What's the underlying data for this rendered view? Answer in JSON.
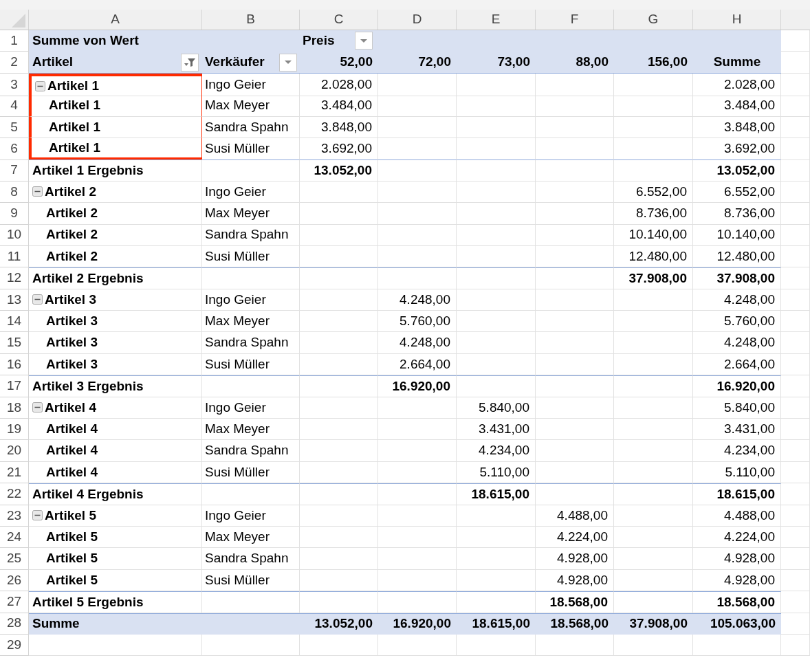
{
  "columns": [
    "A",
    "B",
    "C",
    "D",
    "E",
    "F",
    "G",
    "H"
  ],
  "rows": [
    {
      "number": "1",
      "kind": "title",
      "label": "Summe von Wert",
      "column_field": {
        "label": "Preis",
        "filtered": false
      }
    },
    {
      "number": "2",
      "kind": "header",
      "row_field": {
        "label": "Artikel",
        "filtered": true
      },
      "second_field": {
        "label": "Verkäufer",
        "filtered": false
      },
      "headings": [
        "52,00",
        "72,00",
        "73,00",
        "88,00",
        "156,00",
        "Summe"
      ]
    },
    {
      "number": "3",
      "kind": "item",
      "expanded": true,
      "highlighted": true,
      "article": "Artikel 1",
      "seller": "Ingo Geier",
      "values": {
        "c": "2.028,00",
        "h": "2.028,00"
      }
    },
    {
      "number": "4",
      "kind": "item",
      "highlighted": true,
      "article": "Artikel 1",
      "seller": "Max Meyer",
      "values": {
        "c": "3.484,00",
        "h": "3.484,00"
      }
    },
    {
      "number": "5",
      "kind": "item",
      "highlighted": true,
      "article": "Artikel 1",
      "seller": "Sandra Spahn",
      "values": {
        "c": "3.848,00",
        "h": "3.848,00"
      }
    },
    {
      "number": "6",
      "kind": "item",
      "highlighted": true,
      "article": "Artikel 1",
      "seller": "Susi Müller",
      "values": {
        "c": "3.692,00",
        "h": "3.692,00"
      }
    },
    {
      "number": "7",
      "kind": "subtotal",
      "article": "Artikel 1 Ergebnis",
      "values": {
        "c": "13.052,00",
        "h": "13.052,00"
      }
    },
    {
      "number": "8",
      "kind": "item",
      "expanded": true,
      "article": "Artikel 2",
      "seller": "Ingo Geier",
      "values": {
        "g": "6.552,00",
        "h": "6.552,00"
      }
    },
    {
      "number": "9",
      "kind": "item",
      "article": "Artikel 2",
      "seller": "Max Meyer",
      "values": {
        "g": "8.736,00",
        "h": "8.736,00"
      }
    },
    {
      "number": "10",
      "kind": "item",
      "article": "Artikel 2",
      "seller": "Sandra Spahn",
      "values": {
        "g": "10.140,00",
        "h": "10.140,00"
      }
    },
    {
      "number": "11",
      "kind": "item",
      "article": "Artikel 2",
      "seller": "Susi Müller",
      "values": {
        "g": "12.480,00",
        "h": "12.480,00"
      }
    },
    {
      "number": "12",
      "kind": "subtotal",
      "article": "Artikel 2 Ergebnis",
      "values": {
        "g": "37.908,00",
        "h": "37.908,00"
      }
    },
    {
      "number": "13",
      "kind": "item",
      "expanded": true,
      "article": "Artikel 3",
      "seller": "Ingo Geier",
      "values": {
        "d": "4.248,00",
        "h": "4.248,00"
      }
    },
    {
      "number": "14",
      "kind": "item",
      "article": "Artikel 3",
      "seller": "Max Meyer",
      "values": {
        "d": "5.760,00",
        "h": "5.760,00"
      }
    },
    {
      "number": "15",
      "kind": "item",
      "article": "Artikel 3",
      "seller": "Sandra Spahn",
      "values": {
        "d": "4.248,00",
        "h": "4.248,00"
      }
    },
    {
      "number": "16",
      "kind": "item",
      "article": "Artikel 3",
      "seller": "Susi Müller",
      "values": {
        "d": "2.664,00",
        "h": "2.664,00"
      }
    },
    {
      "number": "17",
      "kind": "subtotal",
      "article": "Artikel 3 Ergebnis",
      "values": {
        "d": "16.920,00",
        "h": "16.920,00"
      }
    },
    {
      "number": "18",
      "kind": "item",
      "expanded": true,
      "article": "Artikel 4",
      "seller": "Ingo Geier",
      "values": {
        "e": "5.840,00",
        "h": "5.840,00"
      }
    },
    {
      "number": "19",
      "kind": "item",
      "article": "Artikel 4",
      "seller": "Max Meyer",
      "values": {
        "e": "3.431,00",
        "h": "3.431,00"
      }
    },
    {
      "number": "20",
      "kind": "item",
      "article": "Artikel 4",
      "seller": "Sandra Spahn",
      "values": {
        "e": "4.234,00",
        "h": "4.234,00"
      }
    },
    {
      "number": "21",
      "kind": "item",
      "article": "Artikel 4",
      "seller": "Susi Müller",
      "values": {
        "e": "5.110,00",
        "h": "5.110,00"
      }
    },
    {
      "number": "22",
      "kind": "subtotal",
      "article": "Artikel 4 Ergebnis",
      "values": {
        "e": "18.615,00",
        "h": "18.615,00"
      }
    },
    {
      "number": "23",
      "kind": "item",
      "expanded": true,
      "article": "Artikel 5",
      "seller": "Ingo Geier",
      "values": {
        "f": "4.488,00",
        "h": "4.488,00"
      }
    },
    {
      "number": "24",
      "kind": "item",
      "article": "Artikel 5",
      "seller": "Max Meyer",
      "values": {
        "f": "4.224,00",
        "h": "4.224,00"
      }
    },
    {
      "number": "25",
      "kind": "item",
      "article": "Artikel 5",
      "seller": "Sandra Spahn",
      "values": {
        "f": "4.928,00",
        "h": "4.928,00"
      }
    },
    {
      "number": "26",
      "kind": "item",
      "article": "Artikel 5",
      "seller": "Susi Müller",
      "values": {
        "f": "4.928,00",
        "h": "4.928,00"
      }
    },
    {
      "number": "27",
      "kind": "subtotal",
      "article": "Artikel 5 Ergebnis",
      "values": {
        "f": "18.568,00",
        "h": "18.568,00"
      }
    },
    {
      "number": "28",
      "kind": "total",
      "article": "Summe",
      "values": {
        "c": "13.052,00",
        "d": "16.920,00",
        "e": "18.615,00",
        "f": "18.568,00",
        "g": "37.908,00",
        "h": "105.063,00"
      }
    },
    {
      "number": "29",
      "kind": "empty"
    }
  ]
}
